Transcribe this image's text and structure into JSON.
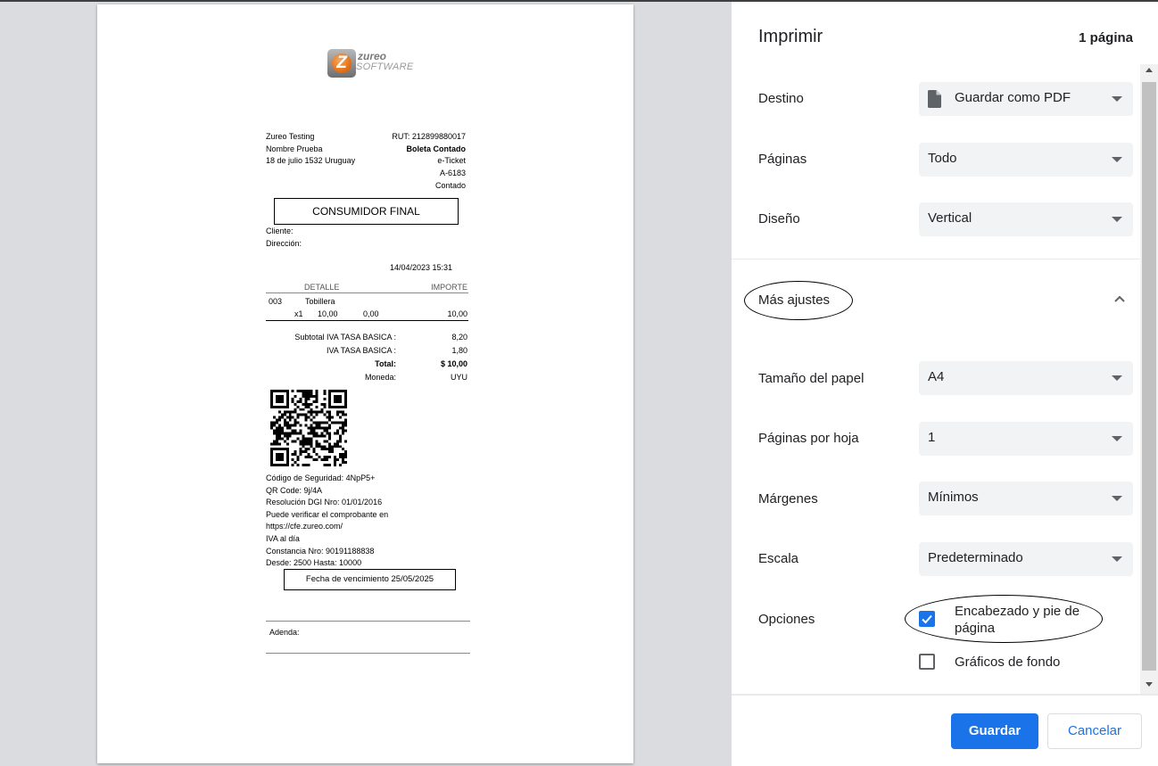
{
  "receipt": {
    "logo": {
      "word1": "zureo",
      "word2": "SOFTWARE"
    },
    "company": {
      "name": "Zureo Testing",
      "contact": "Nombre Prueba",
      "address": "18 de julio 1532 Uruguay"
    },
    "header_right": [
      "RUT: 212899880017",
      "Boleta Contado",
      "e-Ticket",
      "A-6183",
      "Contado"
    ],
    "consumer_box": "CONSUMIDOR FINAL",
    "client_label": "Cliente:",
    "address_label": "Dirección:",
    "datetime": "14/04/2023 15:31",
    "columns": {
      "detail": "DETALLE",
      "amount": "IMPORTE"
    },
    "item": {
      "code": "003",
      "name": "Tobillera",
      "qty": "x1",
      "price": "10,00",
      "discount": "0,00",
      "amount": "10,00"
    },
    "totals": [
      {
        "label": "Subtotal IVA TASA BASICA :",
        "value": "8,20"
      },
      {
        "label": "IVA TASA BASICA :",
        "value": "1,80"
      },
      {
        "label": "Total:",
        "value": "$ 10,00"
      },
      {
        "label": "Moneda:",
        "value": "UYU"
      }
    ],
    "footer_lines": [
      "Código de Seguridad: 4NpP5+",
      "QR Code: 9j/4A",
      "Resolución DGI Nro: 01/01/2016",
      "Puede verificar el comprobante en",
      "https://cfe.zureo.com/",
      "IVA al día",
      "Constancia Nro: 90191188838",
      "Desde: 2500 Hasta: 10000"
    ],
    "expiry_box": "Fecha de vencimiento 25/05/2025",
    "adenda_label": "Adenda:"
  },
  "panel": {
    "title": "Imprimir",
    "page_count": "1 página",
    "destino": {
      "label": "Destino",
      "value": "Guardar como PDF",
      "icon": "file-icon"
    },
    "paginas": {
      "label": "Páginas",
      "value": "Todo"
    },
    "diseno": {
      "label": "Diseño",
      "value": "Vertical"
    },
    "mas_ajustes": {
      "label": "Más ajustes",
      "icon": "chevron-up-icon"
    },
    "tamano": {
      "label": "Tamaño del papel",
      "value": "A4"
    },
    "por_hoja": {
      "label": "Páginas por hoja",
      "value": "1"
    },
    "margenes": {
      "label": "Márgenes",
      "value": "Mínimos"
    },
    "escala": {
      "label": "Escala",
      "value": "Predeterminado"
    },
    "opciones": {
      "label": "Opciones",
      "headers_line1": "Encabezado y pie de",
      "headers_line2": "página",
      "headers_checked": true,
      "background": "Gráficos de fondo",
      "background_checked": false
    },
    "buttons": {
      "save": "Guardar",
      "cancel": "Cancelar"
    },
    "colors": {
      "accent": "#1a73e8",
      "field_bg": "#f1f3f4"
    }
  }
}
